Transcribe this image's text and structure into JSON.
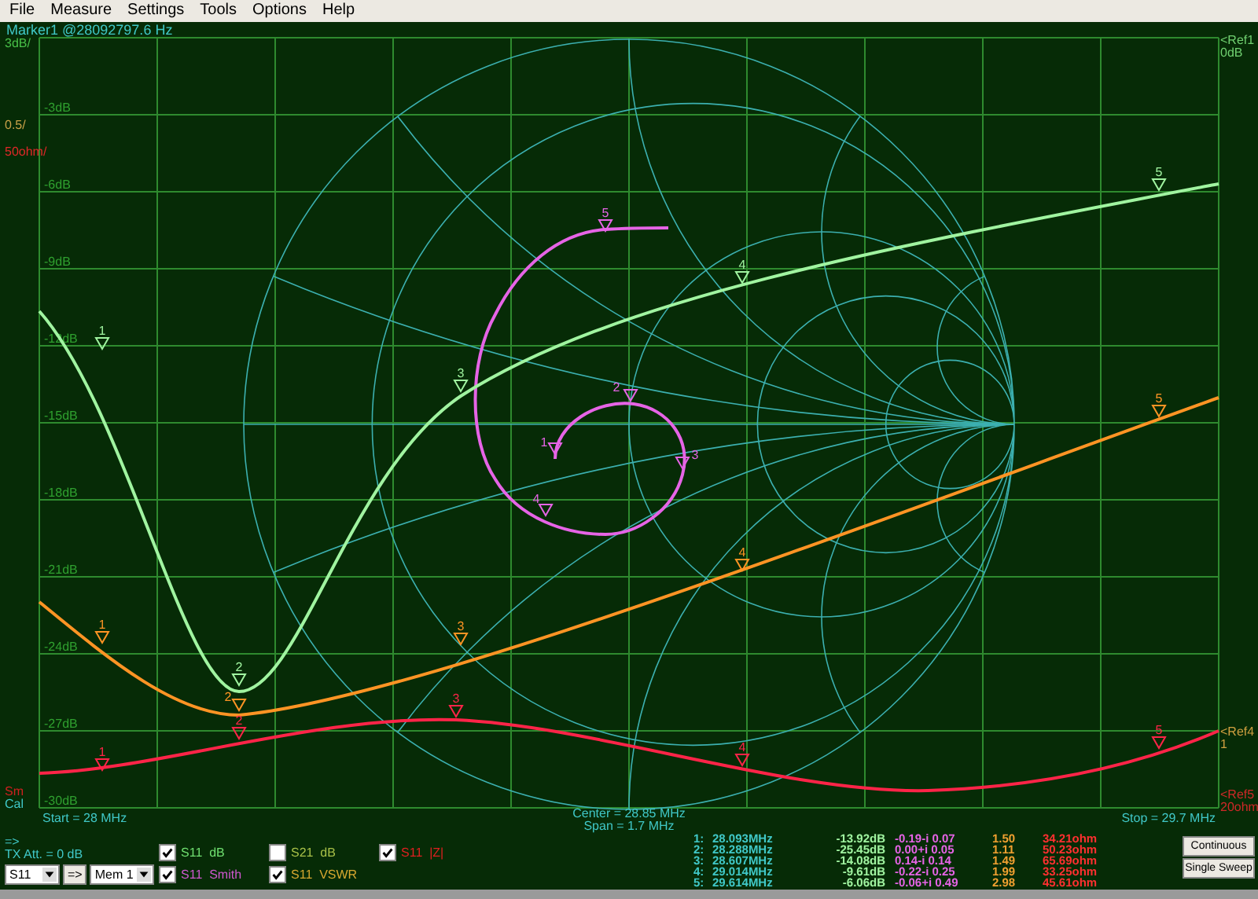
{
  "menu": [
    "File",
    "Measure",
    "Settings",
    "Tools",
    "Options",
    "Help"
  ],
  "marker_readout": "Marker1 @28092797.6 Hz",
  "scales": [
    {
      "text": "3dB/",
      "color": "#48c048"
    },
    {
      "text": "0.5/",
      "color": "#c8a048"
    },
    {
      "text": "50ohm/",
      "color": "#e02828"
    }
  ],
  "y_ticks": [
    "-3dB",
    "-6dB",
    "-9dB",
    "-12dB",
    "-15dB",
    "-18dB",
    "-21dB",
    "-24dB",
    "-27dB",
    "-30dB"
  ],
  "refs": [
    {
      "marker": "<Ref1",
      "value": "0dB",
      "color": "#70d070"
    },
    {
      "marker": "<Ref4",
      "value": "1",
      "color": "#d0a040"
    },
    {
      "marker": "<Ref5",
      "value": "20ohm",
      "color": "#d02828"
    }
  ],
  "status_flags": [
    {
      "text": "Sm",
      "color": "#d02020"
    },
    {
      "text": "Cal",
      "color": "#40c8c8"
    }
  ],
  "sweep": {
    "start": "Start = 28 MHz",
    "center": "Center = 28.85 MHz",
    "span": "Span = 1.7 MHz",
    "stop": "Stop = 29.7 MHz"
  },
  "traces": [
    {
      "kind": "smith",
      "color": "#e664e6",
      "markers": [
        "1",
        "2",
        "3",
        "4",
        "5"
      ]
    },
    {
      "kind": "rect",
      "color": "#a0f4a0",
      "markers": [
        "1",
        "2",
        "3",
        "4",
        "5"
      ]
    },
    {
      "kind": "rect",
      "color": "#ff9424",
      "markers": [
        "1",
        "2",
        "3",
        "4",
        "5"
      ]
    },
    {
      "kind": "rect",
      "color": "#ff2448",
      "markers": [
        "1",
        "2",
        "3",
        "4",
        "5"
      ]
    }
  ],
  "port": {
    "arrow": "=>",
    "tx_att": "TX Att. = 0 dB",
    "param": "S11",
    "copy_button": "=>",
    "memory": "Mem 1"
  },
  "checkboxes": [
    {
      "label": "S11  dB",
      "checked": true,
      "color": "#70e070"
    },
    {
      "label": "S11  Smith",
      "checked": true,
      "color": "#d058d0"
    },
    {
      "label": "S21  dB",
      "checked": false,
      "color": "#a8c048"
    },
    {
      "label": "S11  VSWR",
      "checked": true,
      "color": "#d8a830"
    },
    {
      "label": "S11  |Z|",
      "checked": true,
      "color": "#e02020"
    }
  ],
  "marker_table": [
    {
      "label": "1:",
      "freq": "28.093MHz",
      "db": "-13.92dB",
      "gamma": "-0.19-i 0.07",
      "vswr": "1.50",
      "z": "34.21ohm"
    },
    {
      "label": "2:",
      "freq": "28.288MHz",
      "db": "-25.45dB",
      "gamma": "0.00+i 0.05",
      "vswr": "1.11",
      "z": "50.23ohm"
    },
    {
      "label": "3:",
      "freq": "28.607MHz",
      "db": "-14.08dB",
      "gamma": "0.14-i 0.14",
      "vswr": "1.49",
      "z": "65.69ohm"
    },
    {
      "label": "4:",
      "freq": "29.014MHz",
      "db": "-9.61dB",
      "gamma": "-0.22-i 0.25",
      "vswr": "1.99",
      "z": "33.25ohm"
    },
    {
      "label": "5:",
      "freq": "29.614MHz",
      "db": "-6.06dB",
      "gamma": "-0.06+i 0.49",
      "vswr": "2.98",
      "z": "45.61ohm"
    }
  ],
  "buttons": [
    "Continuous",
    "Single Sweep"
  ]
}
